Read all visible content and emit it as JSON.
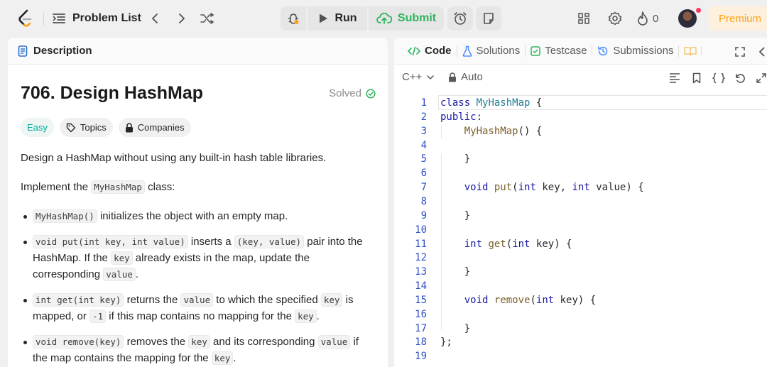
{
  "topbar": {
    "problem_list": "Problem List",
    "run": "Run",
    "submit": "Submit",
    "streak_count": "0",
    "premium": "Premium"
  },
  "left": {
    "tab": "Description",
    "title": "706. Design HashMap",
    "solved": "Solved",
    "tags": [
      "Easy",
      "Topics",
      "Companies"
    ],
    "p1": "Design a HashMap without using any built-in hash table libraries.",
    "p2_pre": "Implement the ",
    "p2_code": "MyHashMap",
    "p2_post": " class:",
    "bullets": [
      {
        "c1": "MyHashMap()",
        "t1": " initializes the object with an empty map."
      },
      {
        "c1": "void put(int key, int value)",
        "t1": " inserts a ",
        "c2": "(key, value)",
        "t2": " pair into the HashMap. If the ",
        "c3": "key",
        "t3": " already exists in the map, update the corresponding ",
        "c4": "value",
        "t4": "."
      },
      {
        "c1": "int get(int key)",
        "t1": " returns the ",
        "c2": "value",
        "t2": " to which the specified ",
        "c3": "key",
        "t3": " is mapped, or ",
        "c4": "-1",
        "t4": " if this map contains no mapping for the ",
        "c5": "key",
        "t5": "."
      },
      {
        "c1": "void remove(key)",
        "t1": " removes the ",
        "c2": "key",
        "t2": " and its corresponding ",
        "c3": "value",
        "t3": " if the map contains the mapping for the ",
        "c4": "key",
        "t4": "."
      }
    ]
  },
  "right": {
    "tabs": [
      "Code",
      "Solutions",
      "Testcase",
      "Submissions"
    ],
    "language": "C++",
    "autosave": "Auto",
    "code_lines": [
      "class MyHashMap {",
      "public:",
      "    MyHashMap() {",
      "",
      "    }",
      "",
      "    void put(int key, int value) {",
      "",
      "    }",
      "",
      "    int get(int key) {",
      "",
      "    }",
      "",
      "    void remove(int key) {",
      "",
      "    }",
      "};",
      ""
    ]
  },
  "colors": {
    "accent_green": "#2db55d",
    "easy": "#00af9b",
    "premium": "#ffa116",
    "line_numbers": "#2f4fc7"
  }
}
